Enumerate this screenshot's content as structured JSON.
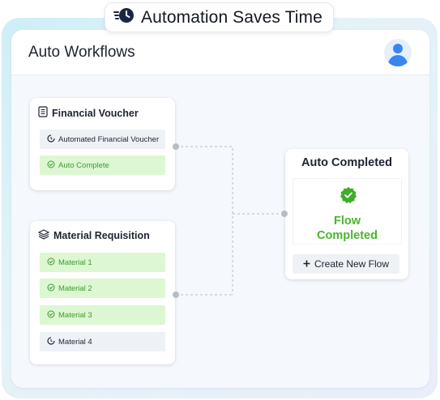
{
  "banner": {
    "title": "Automation Saves Time",
    "icon": "fast-clock-icon"
  },
  "header": {
    "title": "Auto Workflows",
    "avatar_icon": "user-avatar-icon"
  },
  "cards": {
    "financial": {
      "title": "Financial Voucher",
      "icon": "document-icon",
      "items": [
        {
          "label": "Automated Financial Voucher",
          "status": "pending"
        },
        {
          "label": "Auto Complete",
          "status": "done"
        }
      ]
    },
    "material": {
      "title": "Material Requisition",
      "icon": "layers-icon",
      "items": [
        {
          "label": "Material 1",
          "status": "done"
        },
        {
          "label": "Material 2",
          "status": "done"
        },
        {
          "label": "Material 3",
          "status": "done"
        },
        {
          "label": "Material 4",
          "status": "pending"
        }
      ]
    },
    "completed": {
      "title": "Auto Completed",
      "flow_line1": "Flow",
      "flow_line2": "Completed",
      "button_label": "Create New Flow"
    }
  },
  "colors": {
    "done_bg": "#dcf7d2",
    "done_text": "#3f9a33",
    "pending_bg": "#eef1f6",
    "success_green": "#49b52f",
    "accent_blue": "#3a86f0"
  }
}
